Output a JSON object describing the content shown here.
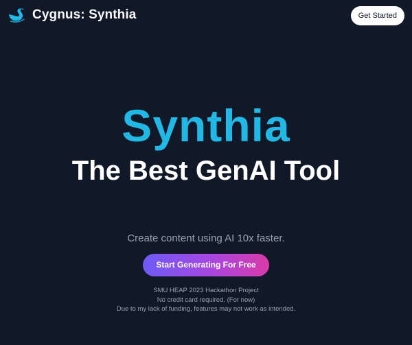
{
  "header": {
    "brand_name": "Cygnus: Synthia",
    "logo_icon": "swan-icon",
    "cta_label": "Get Started"
  },
  "hero": {
    "title": "Synthia",
    "subtitle": "The Best GenAI Tool",
    "tagline": "Create content using AI 10x faster.",
    "cta_label": "Start Generating For Free"
  },
  "footnotes": [
    "SMU HEAP 2023 Hackathon Project",
    "No credit card required. (For now)",
    "Due to my lack of funding, features may not work as intended."
  ],
  "colors": {
    "background": "#111827",
    "accent": "#22b8e6",
    "gradient_start": "#6d5bf5",
    "gradient_end": "#d93aa8"
  }
}
